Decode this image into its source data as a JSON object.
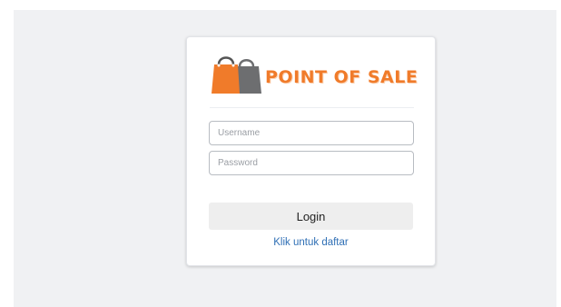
{
  "brand": {
    "name": "POINT OF SALE",
    "logo_icon": "shopping-bags-icon",
    "accent_color": "#f07b2a",
    "bag_colors": [
      "#f07b2a",
      "#6d6e70"
    ]
  },
  "form": {
    "username_placeholder": "Username",
    "password_placeholder": "Password",
    "login_label": "Login",
    "register_link": "Klik untuk daftar"
  }
}
